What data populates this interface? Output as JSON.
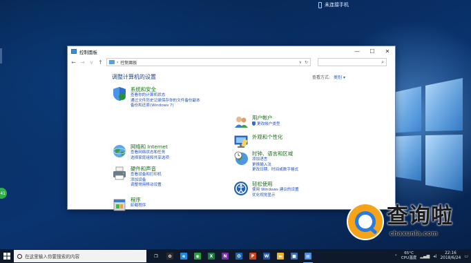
{
  "desktop": {
    "notification": "未连接手机",
    "side_app_label": "41"
  },
  "window": {
    "title": "控制面板",
    "controls": {
      "minimize": "—",
      "maximize": "☐",
      "close": "✕"
    },
    "nav": {
      "back": "←",
      "forward": "→",
      "down": "∨",
      "up": "↑"
    },
    "address_text": "控制面板",
    "address_sep": "›",
    "address_dropdown": "∨",
    "refresh": "↻",
    "search_icon": "⌕"
  },
  "content": {
    "heading": "调整计算机的设置",
    "view_by_label": "查看方式:",
    "view_by_value": "类别 ▾",
    "categories": [
      {
        "title": "系统和安全",
        "links": [
          "查看你的计算机状态",
          "通过文件历史记录保存你的文件备份副本",
          "备份和还原(Windows 7)"
        ],
        "icon": "shield-icon"
      },
      {
        "title": "网络和 Internet",
        "links": [
          "查看网络状态和任务",
          "选择家庭组和共享选项"
        ],
        "icon": "network-globe-icon"
      },
      {
        "title": "硬件和声音",
        "links": [
          "查看设备和打印机",
          "添加设备",
          "调整常用移动设置"
        ],
        "icon": "printer-icon"
      },
      {
        "title": "程序",
        "links": [
          "卸载程序"
        ],
        "icon": "programs-icon"
      },
      {
        "title": "用户帐户",
        "links": [
          "更改帐户类型"
        ],
        "icon": "users-icon"
      },
      {
        "title": "外观和个性化",
        "links": [],
        "icon": "appearance-icon"
      },
      {
        "title": "时钟、语言和区域",
        "links": [
          "添加语言",
          "更换输入法",
          "更改日期、时间或数字格式"
        ],
        "icon": "clock-globe-icon"
      },
      {
        "title": "轻松使用",
        "links": [
          "使用 Windows 建议的设置",
          "优化视觉显示"
        ],
        "icon": "ease-of-access-icon"
      }
    ]
  },
  "taskbar": {
    "search_placeholder": "在这里输入你要搜索的内容",
    "temperature": "65°C",
    "cpu_label": "CPU温度",
    "time": "22:16",
    "date": "2018/6/24",
    "apps": [
      {
        "name": "task-view-icon",
        "glyph": "❐",
        "color": "#0e1a2b"
      },
      {
        "name": "baidu-icon",
        "glyph": "✿",
        "color": "#2b2b2b"
      },
      {
        "name": "edge-icon",
        "glyph": "e",
        "color": "#1e88e5"
      },
      {
        "name": "chrome-icon",
        "glyph": "◉",
        "color": "#2e9d3f"
      },
      {
        "name": "excel-icon",
        "glyph": "X",
        "color": "#1f7a3f"
      },
      {
        "name": "onenote-icon",
        "glyph": "N",
        "color": "#7b2fa8"
      },
      {
        "name": "outlook-icon",
        "glyph": "O",
        "color": "#1a66b8"
      },
      {
        "name": "powerpoint-icon",
        "glyph": "P",
        "color": "#c8451f"
      },
      {
        "name": "word-icon",
        "glyph": "W",
        "color": "#2357a8"
      },
      {
        "name": "explorer-icon",
        "glyph": "▬",
        "color": "#e9b530"
      },
      {
        "name": "app-icon",
        "glyph": "■",
        "color": "#3b6fb5"
      },
      {
        "name": "control-panel-icon",
        "glyph": "▤",
        "color": "#4a8fd8"
      }
    ]
  },
  "watermark": {
    "brand_cn": "查询啦",
    "brand_en": "chaxunla.com"
  }
}
